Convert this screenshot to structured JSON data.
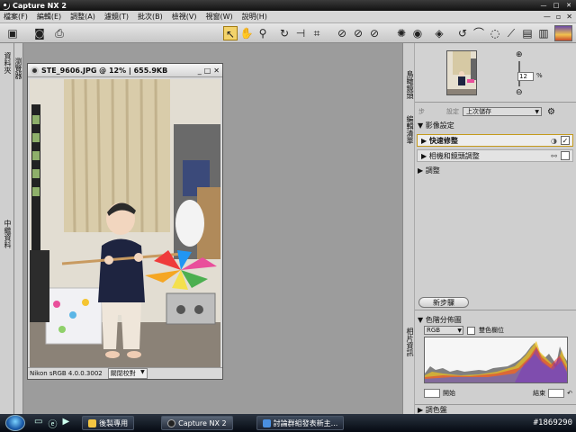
{
  "window": {
    "title": "Capture NX 2"
  },
  "menu": {
    "items": [
      "檔案(F)",
      "編輯(E)",
      "調整(A)",
      "濾鏡(T)",
      "批次(B)",
      "檢視(V)",
      "視窗(W)",
      "說明(H)"
    ]
  },
  "left_dock": {
    "tab1": "資料夾",
    "tab2": "中繼資料",
    "tab3": "瀏覽器"
  },
  "image_window": {
    "title": "STE_9606.JPG @ 12% | 655.9KB",
    "profile": "Nikon sRGB 4.0.0.3002",
    "soft_proof": "關閉校對"
  },
  "right_tabs": {
    "navigator": "鳥瞰鏡頭",
    "edit_list": "編輯清單",
    "histogram": "相片資訊"
  },
  "navigator": {
    "zoom_value": "12",
    "zoom_unit": "%"
  },
  "edit_list": {
    "label_left": "步",
    "label_settings": "設定",
    "settings_value": "上次儲存",
    "section_image_settings": "▼ 影像設定",
    "step_quick_fix": "快速修整",
    "step_camera_lens": "相機和鏡頭調整",
    "section_adjust": "▶ 調整",
    "new_step_button": "新步驟"
  },
  "histogram": {
    "title": "▼ 色階分佈圖",
    "channel": "RGB",
    "dual_label": "雙色欄位",
    "start_label": "開始",
    "end_label": "結束"
  },
  "bottom_section": "▶ 調色盤",
  "taskbar": {
    "tasks": [
      "後製專用",
      "Capture NX 2",
      "討論群組發表新主..."
    ],
    "clock": "#1869290"
  }
}
